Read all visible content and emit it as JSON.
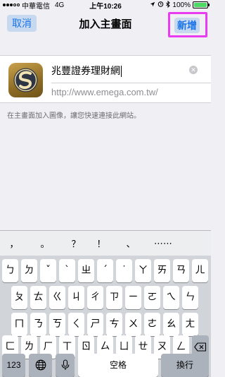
{
  "status_bar": {
    "carrier": "中華電信",
    "network": "4G",
    "time": "上午10:26",
    "battery_text": "100%",
    "battery_level": 1.0
  },
  "nav": {
    "cancel_label": "取消",
    "title": "加入主畫面",
    "add_label": "新增"
  },
  "form": {
    "name_value": "兆豐證券理財網",
    "url_value": "http://www.emega.com.tw/",
    "clear_symbol": "✕"
  },
  "hint": "在主畫面加入圖像，讓您快速連接此網站。",
  "keyboard": {
    "punctuation": [
      "，",
      "。",
      "？",
      "！",
      "、",
      "⋯⋯"
    ],
    "row1": [
      "ㄅ",
      "ㄉ",
      "ˇ",
      "ˋ",
      "ㄓ",
      "ˊ",
      "˙",
      "ㄚ",
      "ㄞ",
      "ㄢ",
      "ㄦ"
    ],
    "row2": [
      "ㄆ",
      "ㄊ",
      "ㄍ",
      "ㄐ",
      "ㄔ",
      "ㄗ",
      "ㄧ",
      "ㄛ",
      "ㄟ",
      "ㄣ"
    ],
    "row3": [
      "ㄇ",
      "ㄋ",
      "ㄎ",
      "ㄑ",
      "ㄕ",
      "ㄘ",
      "ㄨ",
      "ㄜ",
      "ㄠ",
      "ㄤ"
    ],
    "row4": [
      "ㄈ",
      "ㄌ",
      "ㄏ",
      "ㄒ",
      "ㄖ",
      "ㄙ",
      "ㄩ",
      "ㄝ",
      "ㄡ",
      "ㄥ"
    ],
    "numbers_label": "123",
    "space_label": "空格",
    "return_label": "換行"
  }
}
